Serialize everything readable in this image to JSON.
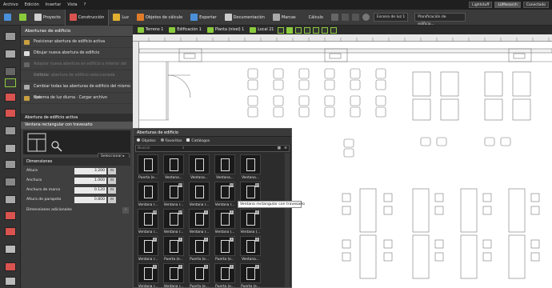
{
  "menubar": {
    "items": [
      "Archivo",
      "Edición",
      "Insertar",
      "Vista",
      "?"
    ],
    "right_tags": [
      "Lightstuff",
      "LUMsearch",
      "Conectado"
    ]
  },
  "mainbar": {
    "tabs": [
      "Proyecto",
      "Construcción",
      "Luz",
      "Objetos de cálculo",
      "Exportar",
      "Documentación",
      "Marcas"
    ],
    "calc_label": "Cálculo",
    "scene_label": "Escena de luz 1",
    "plan_label": "Planificación de edificio..."
  },
  "sidebar": {
    "header": "Aberturas de edificio",
    "items": [
      {
        "label": "Posicionar abertura de edificio activa",
        "enabled": true
      },
      {
        "label": "Dibujar nueva abertura de edificio",
        "enabled": true
      },
      {
        "label": "Adoptar nueva abertura en edificio o interior del edificio",
        "enabled": false
      },
      {
        "label": "Cambiar abertura de edificio seleccionada",
        "enabled": false
      },
      {
        "label": "Cambiar todas las aberturas de edificio del mismo tipo",
        "enabled": true
      },
      {
        "label": "Sistema de luz diurna · Cargar archivo",
        "enabled": true
      }
    ],
    "active_header": "Abertura de edificio activa",
    "active_window": "Ventana rectangular con travesaño",
    "select_button": "Seleccionar",
    "dimensions_header": "Dimensiones",
    "dimensions": [
      {
        "label": "Altura",
        "value": "3.200",
        "unit": "m"
      },
      {
        "label": "Anchura",
        "value": "1.000",
        "unit": "m"
      },
      {
        "label": "Anchura de marco",
        "value": "0.120",
        "unit": "m"
      },
      {
        "label": "Altura de parapeto",
        "value": "0.800",
        "unit": "m"
      }
    ],
    "extra_dims": "Dimensiones adicionales"
  },
  "viewtoolbar": {
    "items": [
      "Terreno 1",
      "Edificación 1",
      "Planta (nivel) 1",
      "Local 21"
    ]
  },
  "flyout": {
    "title": "Aberturas de edificio",
    "tabs": [
      "Objetos",
      "Favoritos",
      "Catálogos"
    ],
    "search_placeholder": "Buscar",
    "tiles": [
      {
        "label": "Puerta (e...",
        "badge": ""
      },
      {
        "label": "Ventana...",
        "badge": ""
      },
      {
        "label": "Ventana...",
        "badge": ""
      },
      {
        "label": "Ventana...",
        "badge": ""
      },
      {
        "label": "Ventana...",
        "badge": ""
      },
      {
        "label": "Ventana r...",
        "badge": ""
      },
      {
        "label": "Ventana r...",
        "badge": "20"
      },
      {
        "label": "Ventana r...",
        "badge": ""
      },
      {
        "label": "Ventana r...",
        "badge": "20"
      },
      {
        "label": "Ventana r...",
        "badge": "20"
      },
      {
        "label": "Ventana r...",
        "badge": "24"
      },
      {
        "label": "Ventana r...",
        "badge": "24"
      },
      {
        "label": "Ventana r...",
        "badge": "2"
      },
      {
        "label": "Ventana (...",
        "badge": "2"
      },
      {
        "label": "Ventana (...",
        "badge": "2"
      },
      {
        "label": "Ventana r...",
        "badge": "2"
      },
      {
        "label": "Puerta (e...",
        "badge": "2"
      },
      {
        "label": "Puerta (e...",
        "badge": "2"
      },
      {
        "label": "Puerta (e...",
        "badge": "2"
      },
      {
        "label": "Ventana...",
        "badge": "2"
      },
      {
        "label": "Ventana r...",
        "badge": "2"
      },
      {
        "label": "Ventana r...",
        "badge": "2"
      },
      {
        "label": "Puerta (e...",
        "badge": "2"
      },
      {
        "label": "Puerta (e...",
        "badge": "2"
      },
      {
        "label": "Puerta (e...",
        "badge": "2"
      }
    ],
    "tooltip": "Ventana rectangular con travesaño"
  },
  "colors": {
    "accent_green": "#8bcc3d",
    "panel": "#3f3f3f",
    "toolbar": "#3b3b3b"
  }
}
